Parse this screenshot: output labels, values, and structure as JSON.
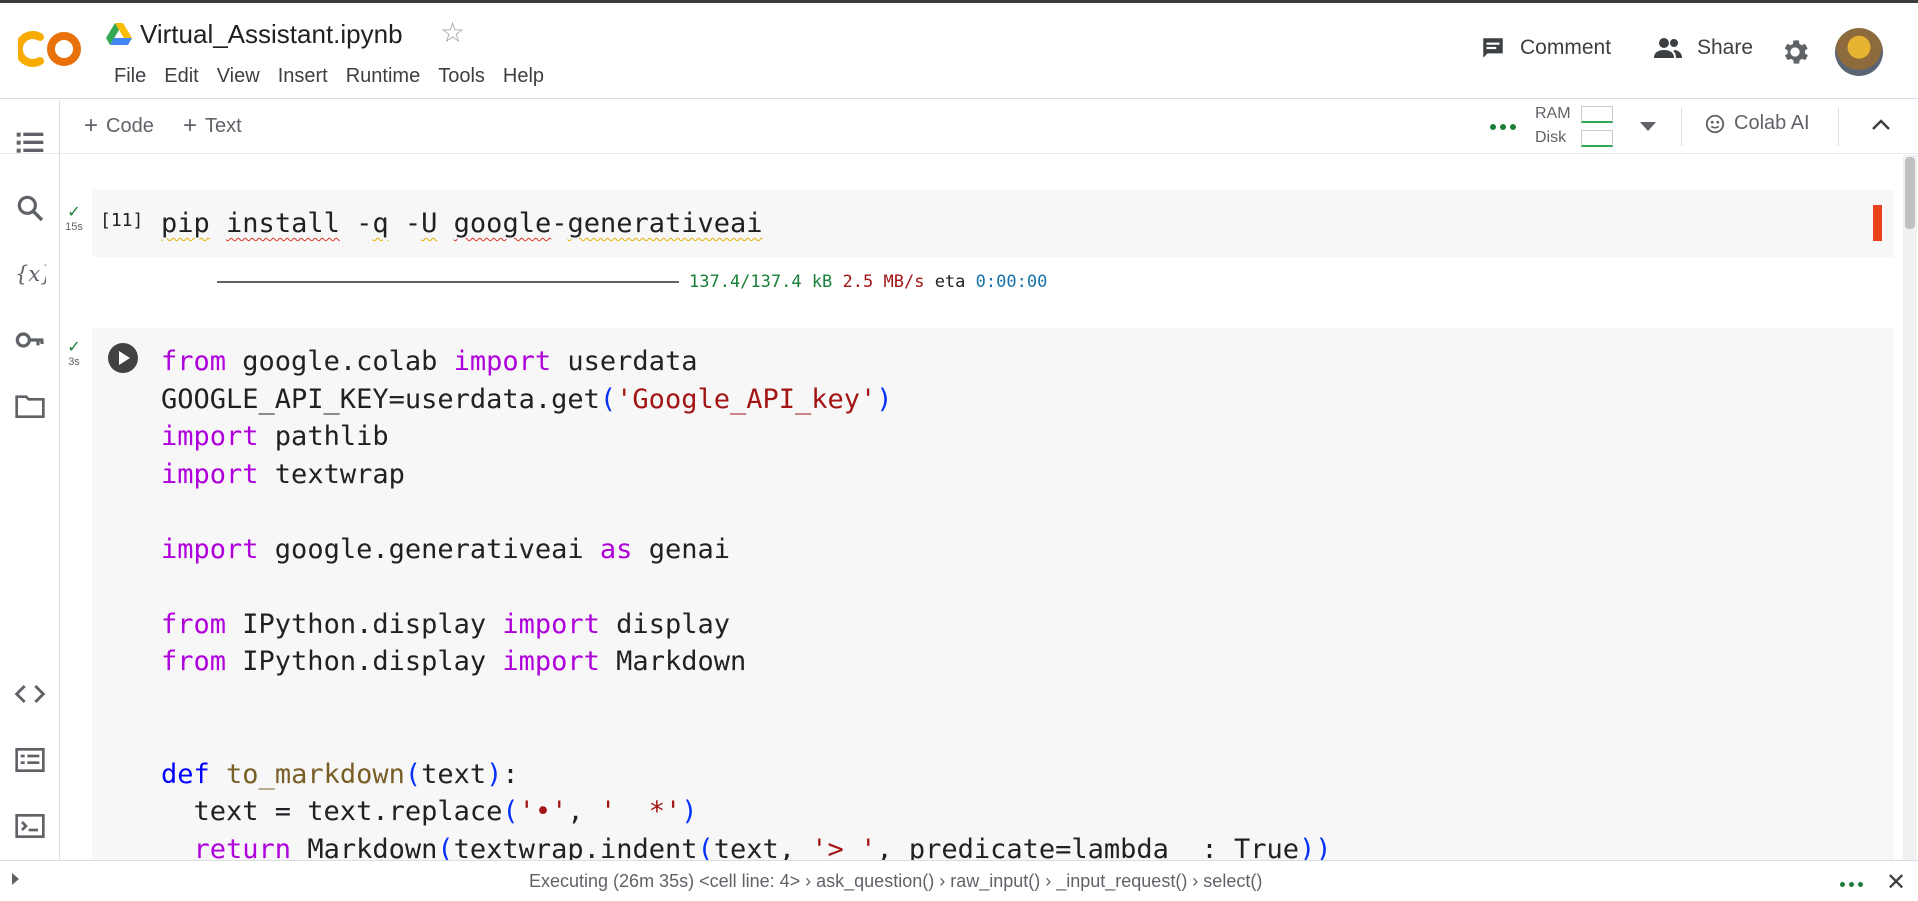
{
  "notebook": {
    "title": "Virtual_Assistant.ipynb",
    "menu": [
      "File",
      "Edit",
      "View",
      "Insert",
      "Runtime",
      "Tools",
      "Help"
    ]
  },
  "header_actions": {
    "comment": "Comment",
    "share": "Share"
  },
  "toolbar": {
    "add_code": "Code",
    "add_text": "Text",
    "ram_label": "RAM",
    "disk_label": "Disk",
    "colab_ai": "Colab AI"
  },
  "cell1": {
    "exec_time": "15s",
    "exec_count": "[11]",
    "code": "pip install -q -U google-generativeai",
    "output": {
      "size": "137.4/137.4 kB",
      "speed": "2.5 MB/s",
      "eta_label": "eta",
      "eta": "0:00:00"
    }
  },
  "cell2": {
    "exec_time": "3s",
    "lines": [
      "from google.colab import userdata",
      "GOOGLE_API_KEY=userdata.get('Google_API_key')",
      "import pathlib",
      "import textwrap",
      "",
      "import google.generativeai as genai",
      "",
      "from IPython.display import display",
      "from IPython.display import Markdown",
      "",
      "",
      "def to_markdown(text):",
      "  text = text.replace('•', '  *')",
      "  return Markdown(textwrap.indent(text, '> ', predicate=lambda _: True))"
    ]
  },
  "status": {
    "text": "Executing (26m 35s) <cell line: 4> › ask_question() › raw_input() › _input_request() › select()"
  },
  "icons": [
    "colab-logo",
    "drive-icon",
    "star-icon",
    "comment-icon",
    "share-icon",
    "gear-icon",
    "toc-icon",
    "search-icon",
    "variables-icon",
    "key-icon",
    "folder-icon",
    "code-snippets-icon",
    "command-palette-icon",
    "terminal-icon",
    "run-icon"
  ],
  "colors": {
    "keyword": "#af00db",
    "def": "#0000ff",
    "function": "#795e26",
    "string": "#a31515",
    "success": "#188038"
  }
}
